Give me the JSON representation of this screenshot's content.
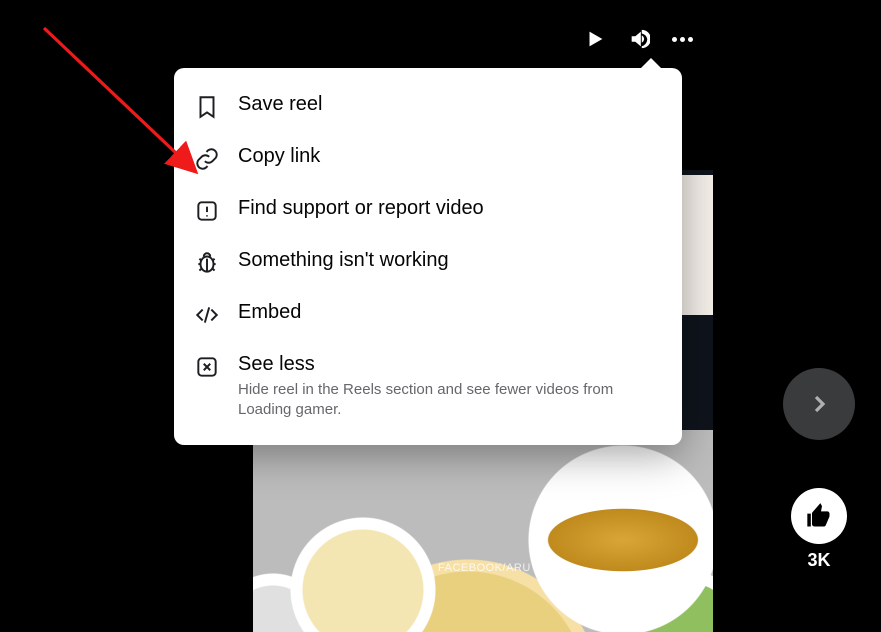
{
  "controls": {
    "play": "Play",
    "volume": "Volume",
    "more": "More options"
  },
  "menu": {
    "save": {
      "label": "Save reel"
    },
    "copy": {
      "label": "Copy link"
    },
    "report": {
      "label": "Find support or report video"
    },
    "bug": {
      "label": "Something isn't working"
    },
    "embed": {
      "label": "Embed"
    },
    "seeless": {
      "label": "See less",
      "subtitle": "Hide reel in the Reels section and see fewer videos from Loading gamer."
    }
  },
  "rail": {
    "next": "Next reel",
    "like_count": "3K"
  },
  "video": {
    "watermark": "FACEBOOK/ARU"
  },
  "annotation": {
    "target": "copy-link-menu-item"
  }
}
